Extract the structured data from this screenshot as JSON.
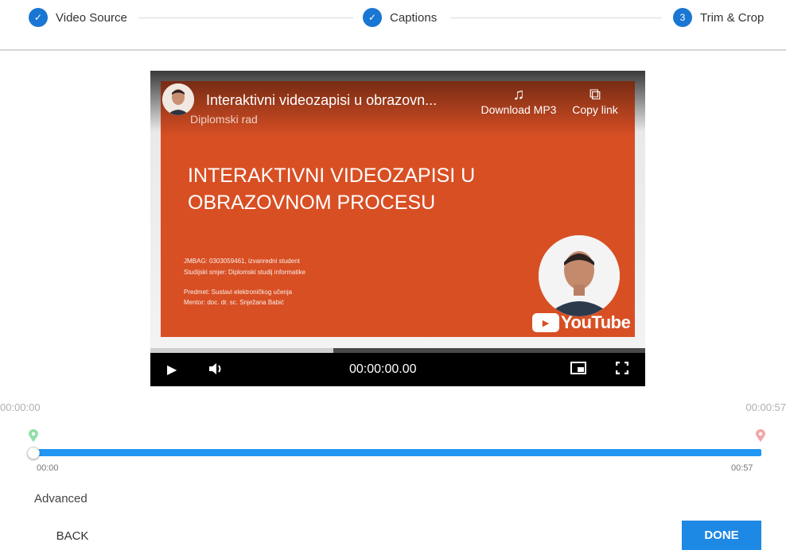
{
  "stepper": {
    "steps": [
      {
        "label": "Video Source",
        "badge": "✓"
      },
      {
        "label": "Captions",
        "badge": "✓"
      },
      {
        "label": "Trim & Crop",
        "badge": "3"
      }
    ]
  },
  "video": {
    "title": "Interaktivni videozapisi u obrazovn...",
    "channel_subtitle": "Diplomski rad",
    "download_label": "Download MP3",
    "copy_label": "Copy link",
    "slide_heading_line1": "INTERAKTIVNI VIDEOZAPISI U",
    "slide_heading_line2": "OBRAZOVNOM PROCESU",
    "slide_line1": "JMBAG: 0303059461, izvanredni student",
    "slide_line2": "Studijski smjer: Diplomski studij informatike",
    "slide_line3": "Predmet: Sustavi elektroničkog učenja",
    "slide_line4": "Mentor: doc. dr. sc. Snježana Babić",
    "logo_text": "YouTube",
    "time": "00:00:00.00",
    "buffered_fraction": 0.37
  },
  "trim": {
    "start_label": "00:00:00",
    "end_label": "00:00:57",
    "tick_start": "00:00",
    "tick_end": "00:57",
    "start_pin_color": "#8fe0a6",
    "end_pin_color": "#f4a6a6",
    "track_color": "#2196f3"
  },
  "footer": {
    "advanced": "Advanced",
    "back": "BACK",
    "done": "DONE"
  },
  "colors": {
    "accent": "#1976d2",
    "slide_orange": "#d84f24"
  }
}
